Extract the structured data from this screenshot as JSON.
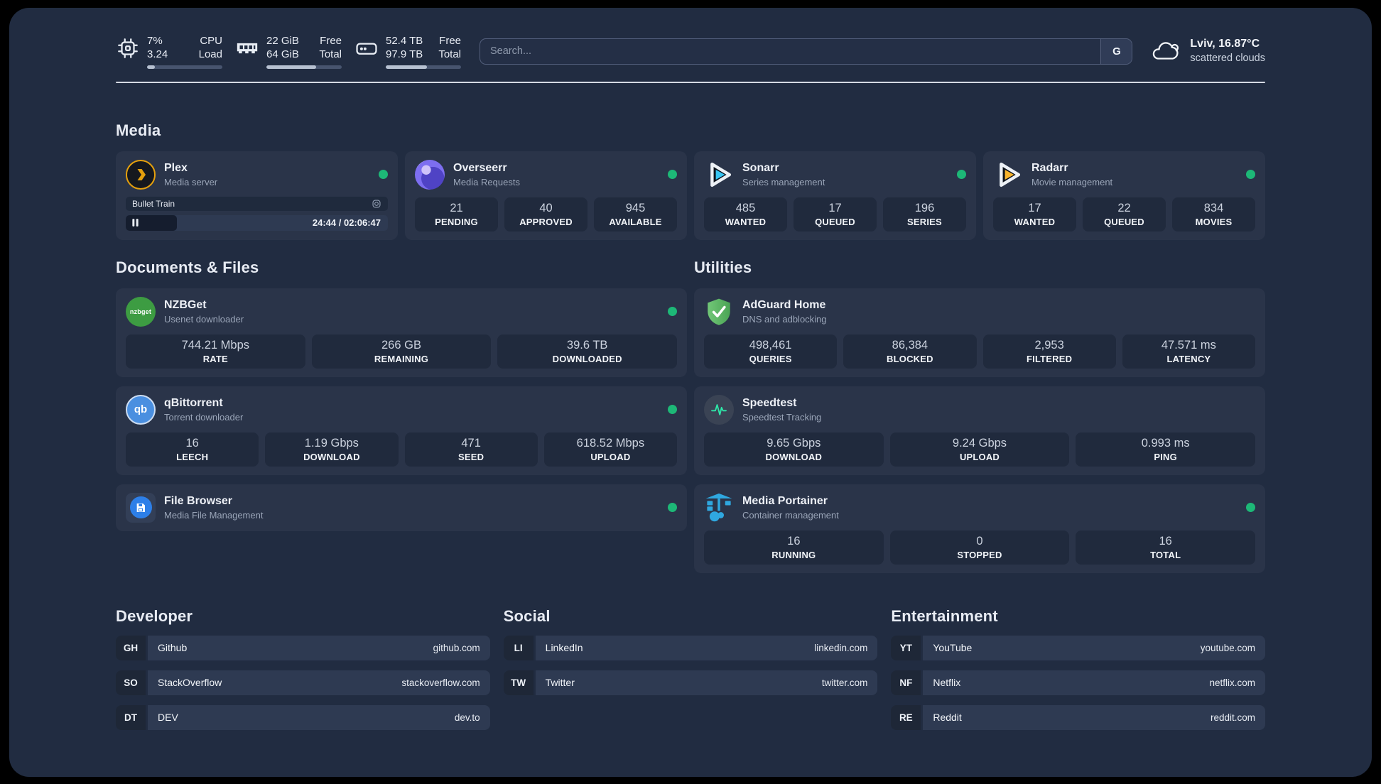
{
  "topbar": {
    "system": {
      "cpu": {
        "values": [
          "7%",
          "3.24"
        ],
        "labels": [
          "CPU",
          "Load"
        ],
        "progress": 10
      },
      "memory": {
        "values": [
          "22 GiB",
          "64 GiB"
        ],
        "labels": [
          "Free",
          "Total"
        ],
        "progress": 66
      },
      "disk": {
        "values": [
          "52.4 TB",
          "97.9 TB"
        ],
        "labels": [
          "Free",
          "Total"
        ],
        "progress": 55
      }
    },
    "search": {
      "placeholder": "Search...",
      "engine_button": "G"
    },
    "weather": {
      "location_temp": "Lviv, 16.87°C",
      "condition": "scattered clouds"
    }
  },
  "sections": {
    "media": "Media",
    "documents": "Documents & Files",
    "utilities": "Utilities",
    "developer": "Developer",
    "social": "Social",
    "entertainment": "Entertainment"
  },
  "apps": {
    "plex": {
      "name": "Plex",
      "subtitle": "Media server",
      "now_playing": "Bullet Train",
      "time": "24:44 / 02:06:47",
      "progress": 19.5
    },
    "overseerr": {
      "name": "Overseerr",
      "subtitle": "Media Requests",
      "stats": [
        {
          "value": "21",
          "label": "PENDING"
        },
        {
          "value": "40",
          "label": "APPROVED"
        },
        {
          "value": "945",
          "label": "AVAILABLE"
        }
      ]
    },
    "sonarr": {
      "name": "Sonarr",
      "subtitle": "Series management",
      "stats": [
        {
          "value": "485",
          "label": "WANTED"
        },
        {
          "value": "17",
          "label": "QUEUED"
        },
        {
          "value": "196",
          "label": "SERIES"
        }
      ]
    },
    "radarr": {
      "name": "Radarr",
      "subtitle": "Movie management",
      "stats": [
        {
          "value": "17",
          "label": "WANTED"
        },
        {
          "value": "22",
          "label": "QUEUED"
        },
        {
          "value": "834",
          "label": "MOVIES"
        }
      ]
    },
    "nzbget": {
      "name": "NZBGet",
      "subtitle": "Usenet downloader",
      "icon_text": "nzbget",
      "stats": [
        {
          "value": "744.21 Mbps",
          "label": "RATE"
        },
        {
          "value": "266 GB",
          "label": "REMAINING"
        },
        {
          "value": "39.6 TB",
          "label": "DOWNLOADED"
        }
      ]
    },
    "qbittorrent": {
      "name": "qBittorrent",
      "subtitle": "Torrent downloader",
      "icon_text": "qb",
      "stats": [
        {
          "value": "16",
          "label": "LEECH"
        },
        {
          "value": "1.19 Gbps",
          "label": "DOWNLOAD"
        },
        {
          "value": "471",
          "label": "SEED"
        },
        {
          "value": "618.52 Mbps",
          "label": "UPLOAD"
        }
      ]
    },
    "filebrowser": {
      "name": "File Browser",
      "subtitle": "Media File Management"
    },
    "adguard": {
      "name": "AdGuard Home",
      "subtitle": "DNS and adblocking",
      "stats": [
        {
          "value": "498,461",
          "label": "QUERIES"
        },
        {
          "value": "86,384",
          "label": "BLOCKED"
        },
        {
          "value": "2,953",
          "label": "FILTERED"
        },
        {
          "value": "47.571 ms",
          "label": "LATENCY"
        }
      ]
    },
    "speedtest": {
      "name": "Speedtest",
      "subtitle": "Speedtest Tracking",
      "stats": [
        {
          "value": "9.65 Gbps",
          "label": "DOWNLOAD"
        },
        {
          "value": "9.24 Gbps",
          "label": "UPLOAD"
        },
        {
          "value": "0.993 ms",
          "label": "PING"
        }
      ]
    },
    "portainer": {
      "name": "Media Portainer",
      "subtitle": "Container management",
      "stats": [
        {
          "value": "16",
          "label": "RUNNING"
        },
        {
          "value": "0",
          "label": "STOPPED"
        },
        {
          "value": "16",
          "label": "TOTAL"
        }
      ]
    }
  },
  "links": {
    "developer": [
      {
        "abbr": "GH",
        "name": "Github",
        "domain": "github.com"
      },
      {
        "abbr": "SO",
        "name": "StackOverflow",
        "domain": "stackoverflow.com"
      },
      {
        "abbr": "DT",
        "name": "DEV",
        "domain": "dev.to"
      }
    ],
    "social": [
      {
        "abbr": "LI",
        "name": "LinkedIn",
        "domain": "linkedin.com"
      },
      {
        "abbr": "TW",
        "name": "Twitter",
        "domain": "twitter.com"
      }
    ],
    "entertainment": [
      {
        "abbr": "YT",
        "name": "YouTube",
        "domain": "youtube.com"
      },
      {
        "abbr": "NF",
        "name": "Netflix",
        "domain": "netflix.com"
      },
      {
        "abbr": "RE",
        "name": "Reddit",
        "domain": "reddit.com"
      }
    ]
  },
  "colors": {
    "status_online": "#1db877",
    "plex_accent": "#e5a00d"
  }
}
